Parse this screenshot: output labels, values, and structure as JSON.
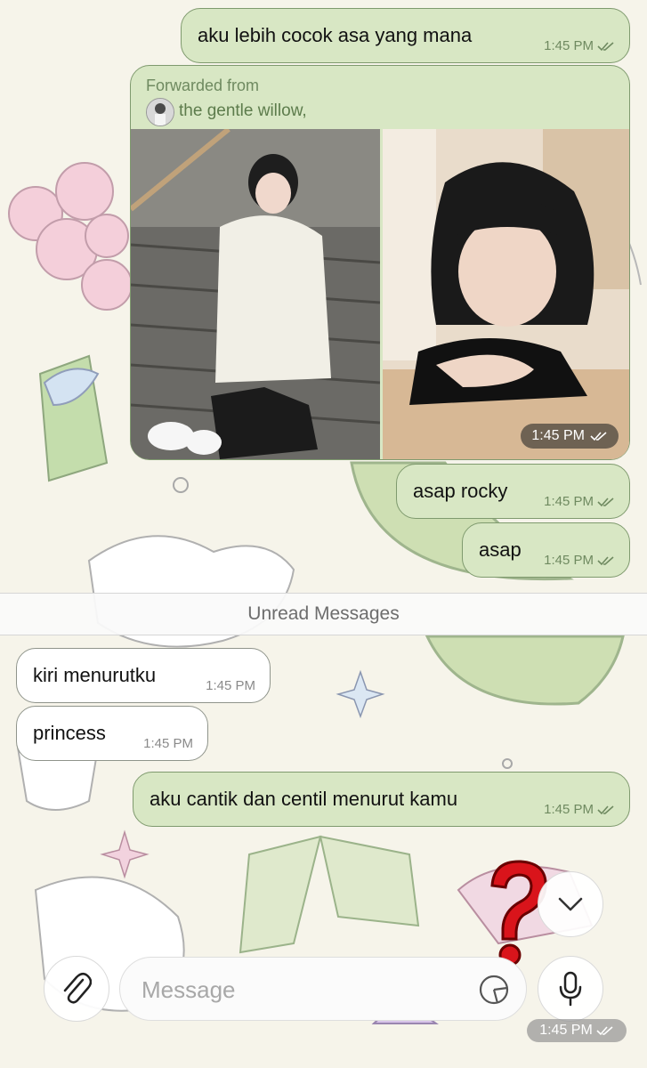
{
  "messages": [
    {
      "text": "aku lebih cocok asa yang mana",
      "time": "1:45 PM"
    },
    {
      "forwarded_label": "Forwarded from",
      "forwarded_name": "the gentle willow,",
      "time": "1:45 PM"
    },
    {
      "text": "asap rocky",
      "time": "1:45 PM"
    },
    {
      "text": "asap",
      "time": "1:45 PM"
    },
    {
      "text": "kiri menurutku",
      "time": "1:45 PM"
    },
    {
      "text": "princess",
      "time": "1:45 PM"
    },
    {
      "text": "aku cantik dan centil menurut kamu",
      "time": "1:45 PM"
    }
  ],
  "unread_label": "Unread Messages",
  "composer": {
    "placeholder": "Message",
    "overlay_time": "1:45 PM"
  },
  "icons": {
    "attach": "paperclip-icon",
    "sticker": "sticker-icon",
    "mic": "microphone-icon",
    "scroll": "chevron-down-icon",
    "question": "red-question-mark-icon"
  },
  "colors": {
    "outgoing": "#d8e7c4",
    "incoming": "#ffffff",
    "accent": "#6f8a60",
    "unread_bar": "#fafafa"
  }
}
